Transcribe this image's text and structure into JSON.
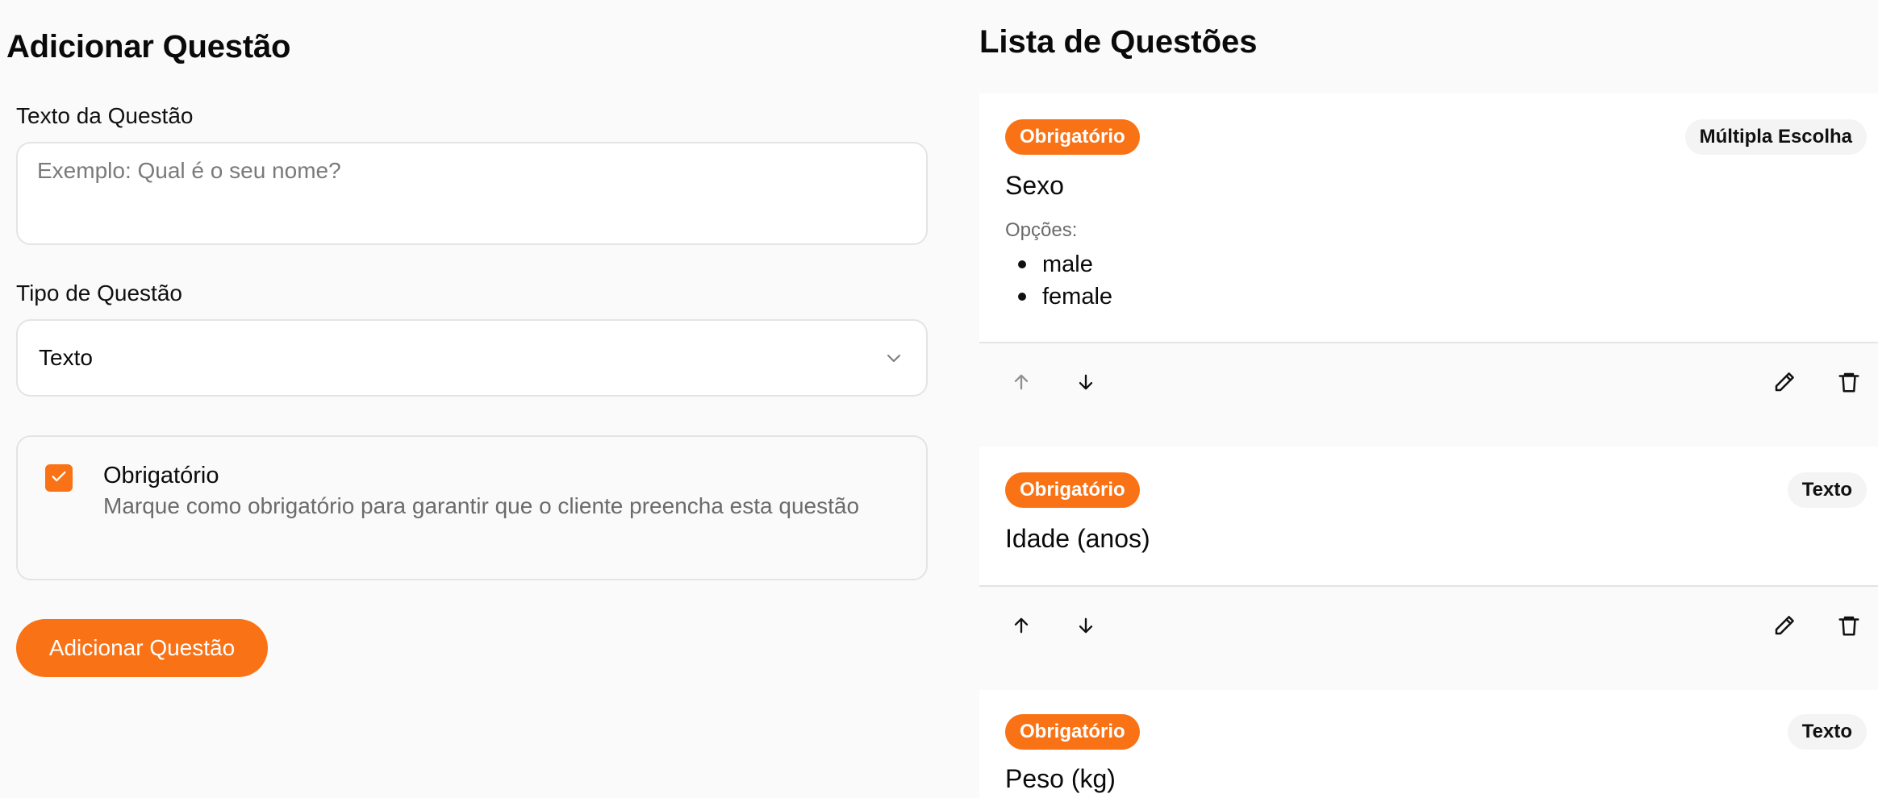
{
  "form": {
    "title": "Adicionar Questão",
    "question_text_label": "Texto da Questão",
    "question_text_placeholder": "Exemplo: Qual é o seu nome?",
    "question_type_label": "Tipo de Questão",
    "question_type_value": "Texto",
    "required_checked": true,
    "required_label": "Obrigatório",
    "required_description": "Marque como obrigatório para garantir que o cliente preencha esta questão",
    "submit_label": "Adicionar Questão"
  },
  "list": {
    "title": "Lista de Questões",
    "options_label": "Opções:",
    "questions": [
      {
        "required_badge": "Obrigatório",
        "type_badge": "Múltipla Escolha",
        "title": "Sexo",
        "options": [
          "male",
          "female"
        ]
      },
      {
        "required_badge": "Obrigatório",
        "type_badge": "Texto",
        "title": "Idade (anos)"
      },
      {
        "required_badge": "Obrigatório",
        "type_badge": "Texto",
        "title": "Peso (kg)"
      }
    ]
  },
  "colors": {
    "accent": "#f97316",
    "background": "#fafafa",
    "border": "#e4e4e7"
  },
  "icons": [
    "chevron-down-icon",
    "check-icon",
    "arrow-up-icon",
    "arrow-down-icon",
    "pencil-icon",
    "trash-icon"
  ]
}
